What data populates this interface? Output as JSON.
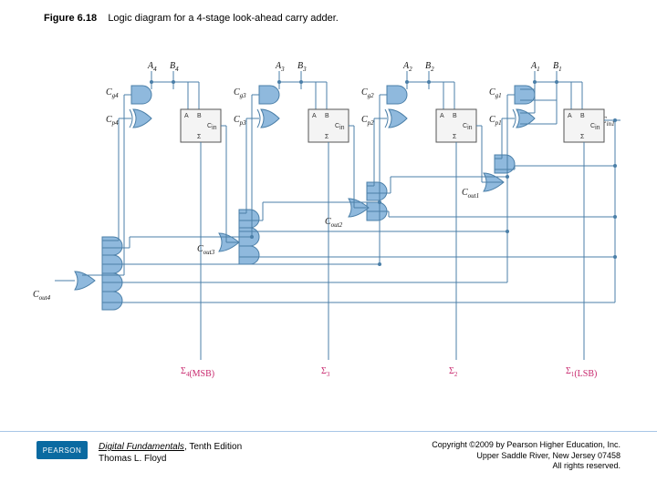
{
  "figure": {
    "number": "Figure 6.18",
    "caption": "Logic diagram for a 4-stage look-ahead carry adder."
  },
  "diagram": {
    "inputs": {
      "stage4": {
        "A": "A4",
        "B": "B4"
      },
      "stage3": {
        "A": "A3",
        "B": "B3"
      },
      "stage2": {
        "A": "A2",
        "B": "B2"
      },
      "stage1": {
        "A": "A1",
        "B": "B1"
      }
    },
    "cin": "Cin1",
    "generate_propagate": {
      "Cg4": "Cg4",
      "Cp4": "Cp4",
      "Cg3": "Cg3",
      "Cp3": "Cp3",
      "Cg2": "Cg2",
      "Cp2": "Cp2",
      "Cg1": "Cg1",
      "Cp1": "Cp1"
    },
    "carry_out": {
      "Cout1": "Cout1",
      "Cout2": "Cout2",
      "Cout3": "Cout3",
      "Cout4": "Cout4"
    },
    "sum_box": {
      "A": "A",
      "B": "B",
      "Cin": "Cin",
      "Sigma": "Σ"
    },
    "sum_outputs": {
      "S4": "Σ4(MSB)",
      "S3": "Σ3",
      "S2": "Σ2",
      "S1": "Σ1(LSB)"
    }
  },
  "footer": {
    "publisher_badge": "PEARSON",
    "book_title": "Digital Fundamentals",
    "edition": ", Tenth Edition",
    "author": "Thomas L. Floyd",
    "copyright_line1": "Copyright ©2009 by Pearson Higher Education, Inc.",
    "copyright_line2": "Upper Saddle River, New Jersey 07458",
    "copyright_line3": "All rights reserved."
  }
}
